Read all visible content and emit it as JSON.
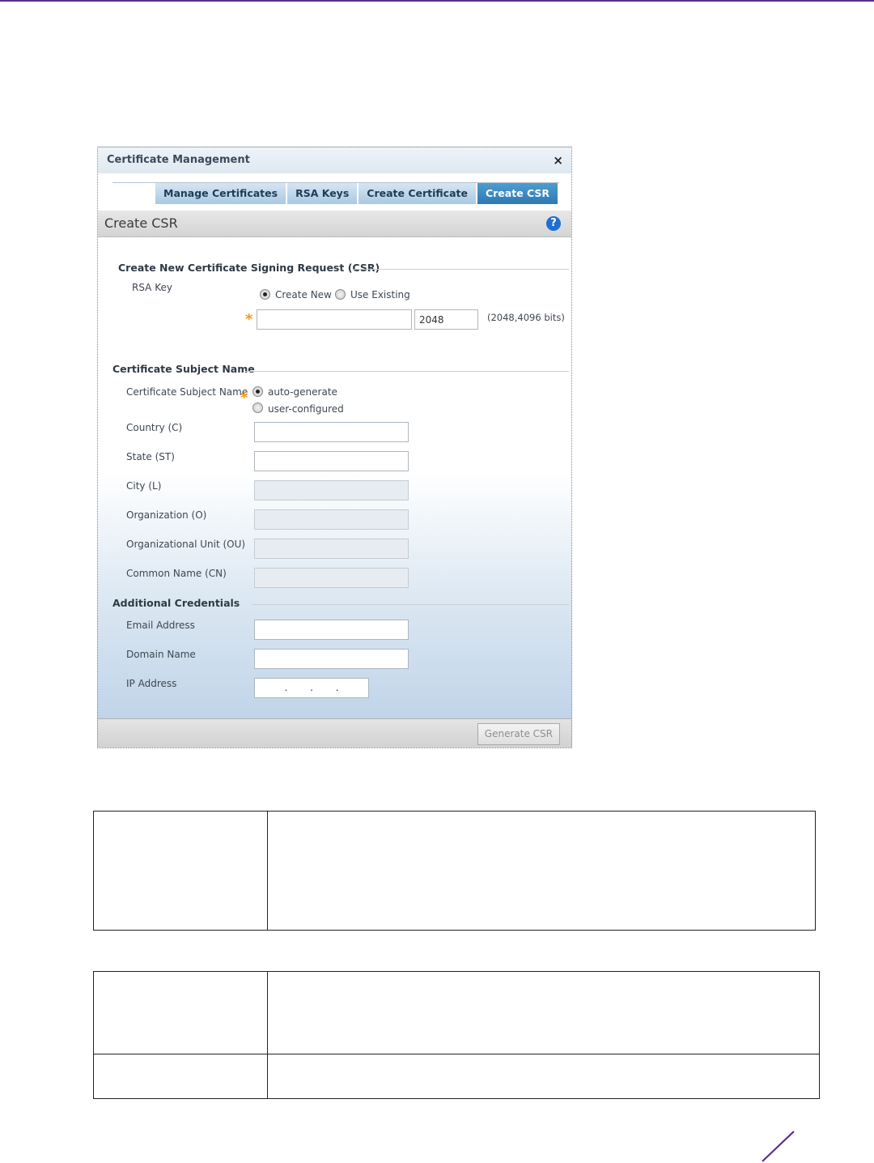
{
  "dialog": {
    "title": "Certificate Management",
    "close_glyph": "×",
    "tabs": [
      {
        "label": "Manage Certificates",
        "active": false
      },
      {
        "label": "RSA Keys",
        "active": false
      },
      {
        "label": "Create Certificate",
        "active": false
      },
      {
        "label": "Create CSR",
        "active": true
      }
    ],
    "header_title": "Create CSR",
    "help_glyph": "?",
    "csr_section": {
      "title": "Create New Certificate Signing Request (CSR)",
      "rsa_key_label": "RSA Key",
      "option_create_new": "Create New",
      "option_use_existing": "Use Existing",
      "selected_option": "Create New",
      "key_name_value": "",
      "key_size_value": "2048",
      "key_size_hint": "(2048,4096 bits)"
    },
    "subject_section": {
      "title": "Certificate Subject Name",
      "subject_name_label": "Certificate Subject Name",
      "option_auto": "auto-generate",
      "option_user": "user-configured",
      "selected_option": "auto-generate",
      "fields": [
        {
          "label": "Country (C)",
          "value": ""
        },
        {
          "label": "State (ST)",
          "value": ""
        },
        {
          "label": "City (L)",
          "value": ""
        },
        {
          "label": "Organization (O)",
          "value": ""
        },
        {
          "label": "Organizational Unit (OU)",
          "value": ""
        },
        {
          "label": "Common Name (CN)",
          "value": ""
        }
      ]
    },
    "credentials_section": {
      "title": "Additional Credentials",
      "email_label": "Email Address",
      "email_value": "",
      "domain_label": "Domain Name",
      "domain_value": "",
      "ip_label": "IP Address",
      "ip_value": ". . ."
    },
    "generate_button": "Generate CSR"
  },
  "colors": {
    "brand_rule": "#5b2d8e",
    "active_tab": "#2f78b3",
    "required_star": "#f39a1c",
    "help_icon": "#1f6fd2"
  }
}
